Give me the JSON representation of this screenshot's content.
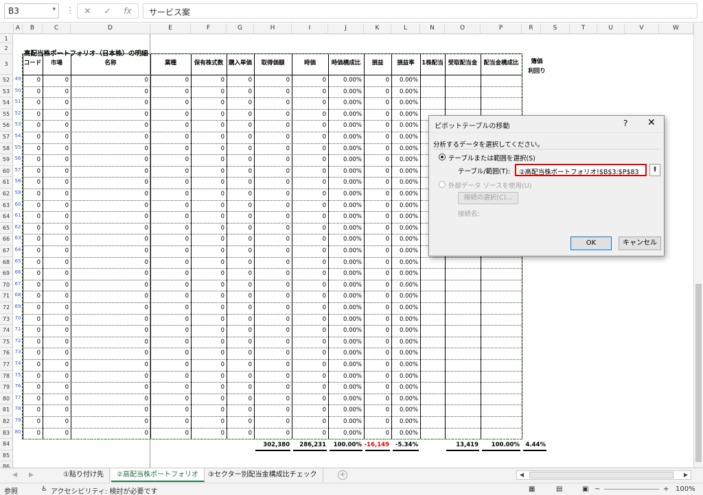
{
  "formula_bar": {
    "name_box": "B3",
    "fx": "fx",
    "content": "サービス案"
  },
  "columns": [
    "A",
    "B",
    "C",
    "D",
    "E",
    "F",
    "G",
    "H",
    "I",
    "J",
    "K",
    "L",
    "N",
    "O",
    "P",
    "R",
    "S",
    "T",
    "U",
    "V",
    "W"
  ],
  "sheet": {
    "title": "高配当株ポートフォリオ（日本株）の明細",
    "headers": [
      "コード",
      "市場",
      "名称",
      "業種",
      "保有株式数",
      "購入単価",
      "取得価額",
      "時価",
      "時価構成比",
      "損益",
      "損益率",
      "1株配当",
      "受取配当金",
      "配当金構成比"
    ],
    "extra_header_line1": "簿価",
    "extra_header_line2": "利回り",
    "rows_start": 52,
    "small_start": 49,
    "row_count": 32,
    "zero": "0",
    "pct_zero": "0.00%",
    "totals": {
      "acquisition": "302,380",
      "market_value": "286,231",
      "market_ratio": "100.00%",
      "pnl": "-16,149",
      "pnl_rate": "-5.34%",
      "dividend_received": "13,419",
      "dividend_ratio": "100.00%",
      "yield": "4.44%"
    },
    "pnl_color": "#e00000"
  },
  "dialog": {
    "title": "ピボットテーブルの移動",
    "help": "?",
    "close": "✕",
    "prompt": "分析するデータを選択してください。",
    "option_table": "テーブルまたは範囲を選択(S)",
    "range_label": "テーブル/範囲(T):",
    "range_value": "②高配当株ポートフォリオ!$B$3:$P$83",
    "option_external": "外部データ ソースを使用(U)",
    "choose_connection": "接続の選択(C)...",
    "connection_name": "接続名:",
    "ok": "OK",
    "cancel": "キャンセル"
  },
  "tabs": [
    {
      "label": "①貼り付け先"
    },
    {
      "label": "②高配当株ポートフォリオ"
    },
    {
      "label": "③セクター別配当金構成比チェック"
    }
  ],
  "status": {
    "mode": "参照",
    "accessibility": "アクセシビリティ: 検討が必要です",
    "zoom": "100%"
  }
}
